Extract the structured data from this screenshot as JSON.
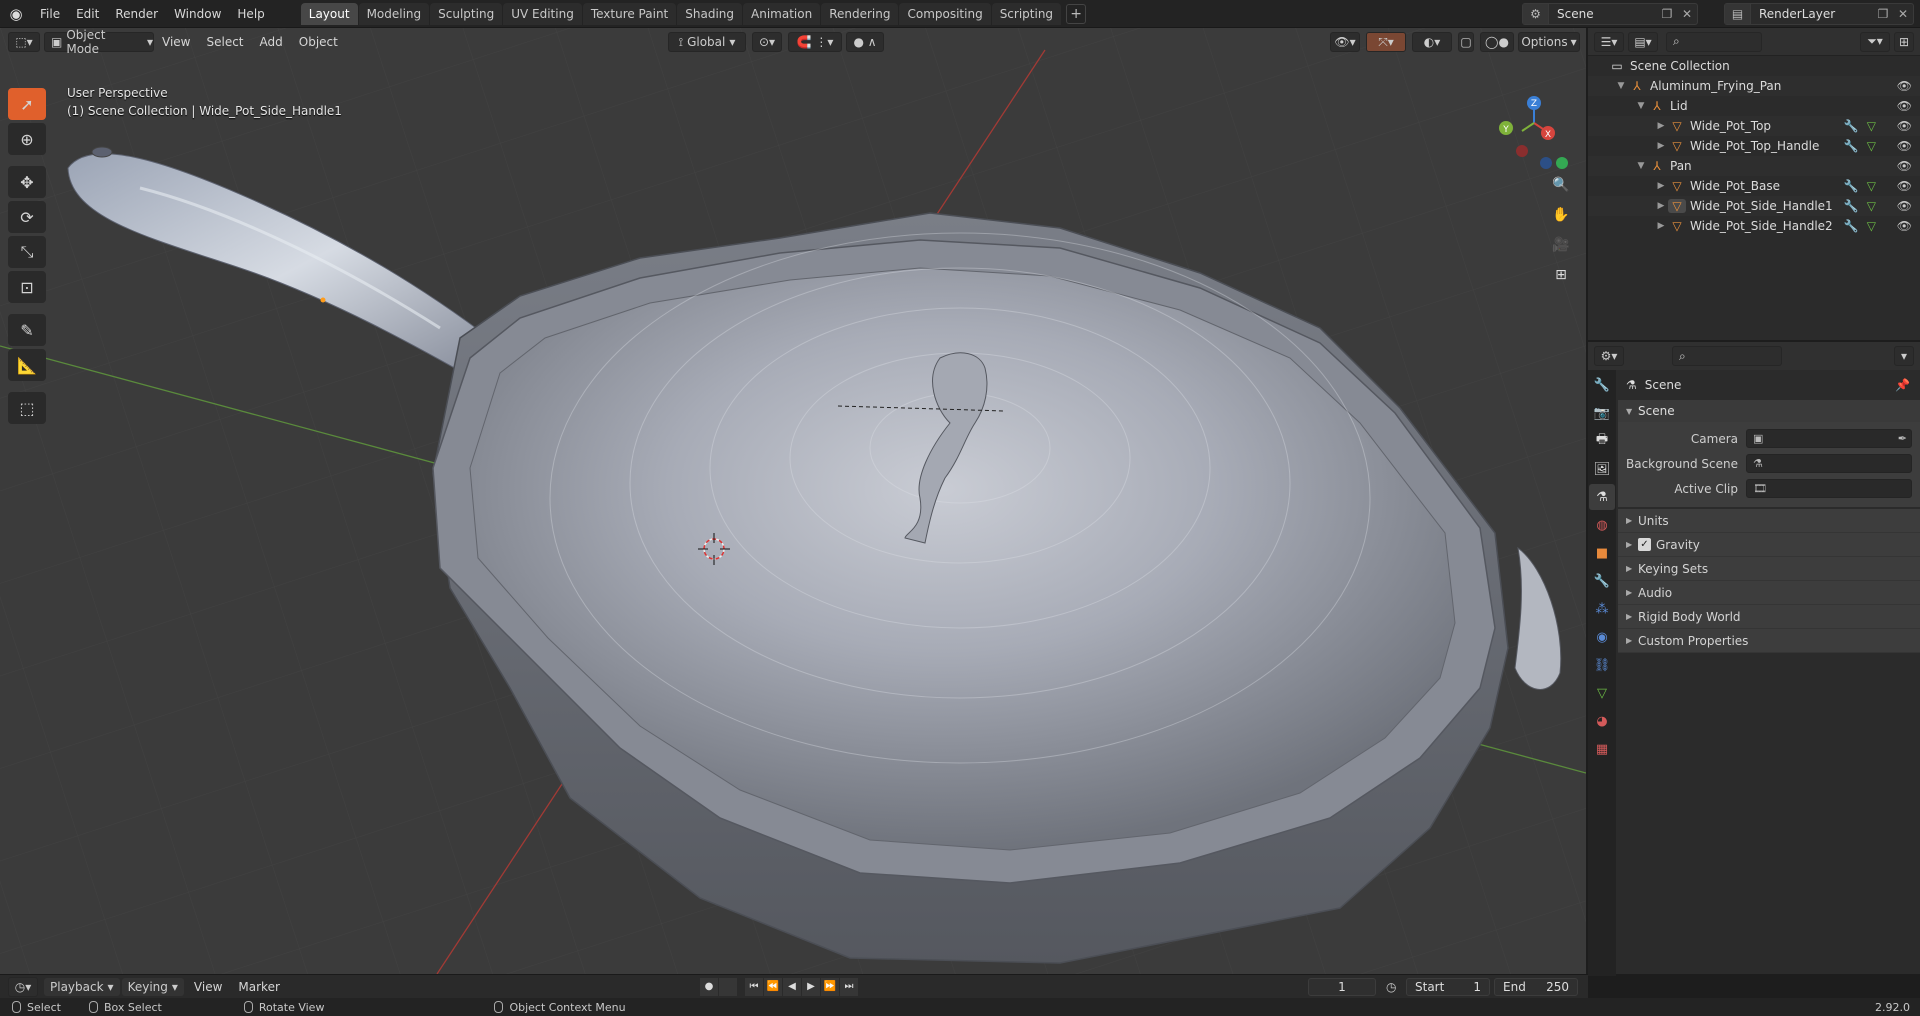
{
  "menubar": {
    "items": [
      "File",
      "Edit",
      "Render",
      "Window",
      "Help"
    ],
    "workspaces": [
      "Layout",
      "Modeling",
      "Sculpting",
      "UV Editing",
      "Texture Paint",
      "Shading",
      "Animation",
      "Rendering",
      "Compositing",
      "Scripting"
    ],
    "active_workspace": "Layout",
    "add_tab": "+",
    "scene_name": "Scene",
    "view_layer": "RenderLayer"
  },
  "viewport": {
    "mode": "Object Mode",
    "menus": [
      "View",
      "Select",
      "Add",
      "Object"
    ],
    "transform_orientation": "Global",
    "options_label": "Options",
    "perspective_label": "User Perspective",
    "context_label": "(1) Scene Collection | Wide_Pot_Side_Handle1",
    "gizmo_axes": {
      "x": "X",
      "y": "Y",
      "z": "Z"
    }
  },
  "outliner": {
    "rows": [
      {
        "label": "Scene Collection",
        "level": 0,
        "icon": "collection-icon",
        "expanded": null
      },
      {
        "label": "Aluminum_Frying_Pan",
        "level": 1,
        "icon": "empty-icon",
        "expanded": true
      },
      {
        "label": "Lid",
        "level": 2,
        "icon": "empty-icon",
        "expanded": true
      },
      {
        "label": "Wide_Pot_Top",
        "level": 3,
        "icon": "mesh-icon",
        "expanded": false
      },
      {
        "label": "Wide_Pot_Top_Handle",
        "level": 3,
        "icon": "mesh-icon",
        "expanded": false
      },
      {
        "label": "Pan",
        "level": 2,
        "icon": "empty-icon",
        "expanded": true
      },
      {
        "label": "Wide_Pot_Base",
        "level": 3,
        "icon": "mesh-icon",
        "expanded": false
      },
      {
        "label": "Wide_Pot_Side_Handle1",
        "level": 3,
        "icon": "mesh-icon",
        "expanded": false
      },
      {
        "label": "Wide_Pot_Side_Handle2",
        "level": 3,
        "icon": "mesh-icon",
        "expanded": false
      }
    ]
  },
  "properties": {
    "context_title": "Scene",
    "scene_panel": {
      "title": "Scene",
      "fields": [
        {
          "label": "Camera",
          "value": ""
        },
        {
          "label": "Background Scene",
          "value": ""
        },
        {
          "label": "Active Clip",
          "value": ""
        }
      ]
    },
    "subpanels": [
      "Units",
      "Gravity",
      "Keying Sets",
      "Audio",
      "Rigid Body World",
      "Custom Properties"
    ],
    "gravity_checked": true
  },
  "timeline": {
    "menus": [
      "Playback",
      "Keying",
      "View",
      "Marker"
    ],
    "current_frame": "1",
    "start_label": "Start",
    "start": "1",
    "end_label": "End",
    "end": "250"
  },
  "statusbar": {
    "select": "Select",
    "box_select": "Box Select",
    "rotate_view": "Rotate View",
    "context_menu": "Object Context Menu",
    "version": "2.92.0"
  },
  "colors": {
    "accent": "#5680c2",
    "active_tool": "#e0602c",
    "selected_row": "#334d80",
    "x_axis": "#d6453e",
    "y_axis": "#7fb23a",
    "z_axis": "#3a7fd6"
  }
}
